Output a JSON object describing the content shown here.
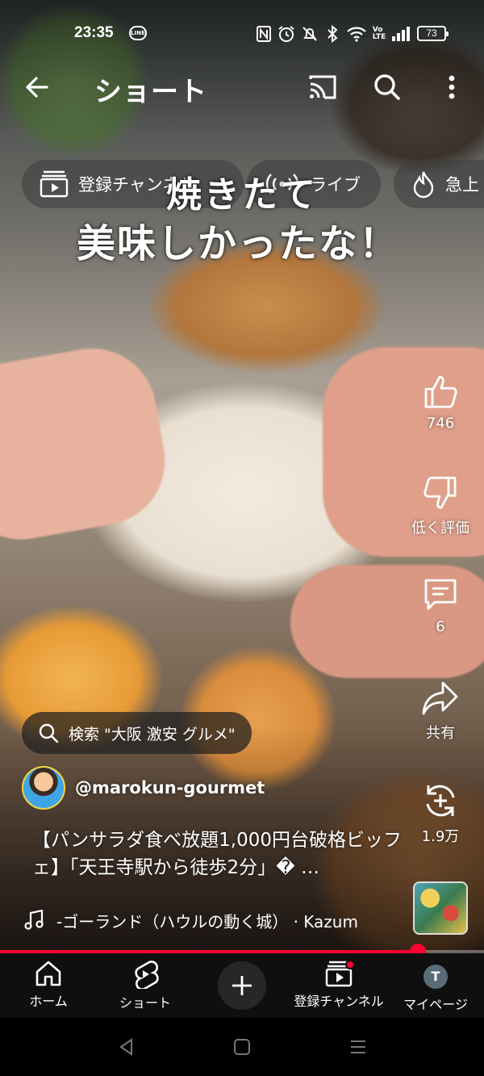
{
  "status_bar": {
    "time": "23:35",
    "line_badge": "LINE",
    "battery": "73",
    "icons": [
      "nfc-icon",
      "alarm-icon",
      "mute-icon",
      "bluetooth-icon",
      "wifi-icon",
      "volte-icon",
      "signal-icon",
      "battery-icon"
    ]
  },
  "header": {
    "title": "ショート",
    "back_icon": "arrow-left-icon",
    "cast_icon": "cast-icon",
    "search_icon": "search-icon",
    "more_icon": "more-vert-icon"
  },
  "chips": [
    {
      "label": "登録チャンネル",
      "icon": "subscriptions-icon"
    },
    {
      "label": "ライブ",
      "icon": "live-icon"
    },
    {
      "label": "急上",
      "icon": "trending-icon"
    }
  ],
  "caption": {
    "line1": "焼きたて",
    "line2": "美味しかったな！"
  },
  "actions": {
    "like_count": "746",
    "dislike_label": "低く評価",
    "comment_count": "6",
    "share_label": "共有",
    "remix_count": "1.9万"
  },
  "search_suggestion": "検索 \"大阪 激安 グルメ\"",
  "channel": {
    "handle": "@marokun-gourmet"
  },
  "video": {
    "title": "【パンサラダ食べ放題1,000円台破格ビッフェ】「天王寺駅から徒歩2分」� …",
    "music": "-ゴーランド（ハウルの動く城） · Kazum",
    "progress": 0.864
  },
  "bottom_nav": {
    "items": [
      {
        "label": "ホーム",
        "icon": "home-icon"
      },
      {
        "label": "ショート",
        "icon": "shorts-icon"
      },
      {
        "label": "",
        "icon": "plus-icon"
      },
      {
        "label": "登録チャンネル",
        "icon": "subscriptions-icon"
      },
      {
        "label": "マイページ",
        "icon": "avatar-icon"
      }
    ],
    "profile_initial": "T"
  },
  "colors": {
    "accent": "#ff0033",
    "nav_bg": "#0f0f0f"
  }
}
